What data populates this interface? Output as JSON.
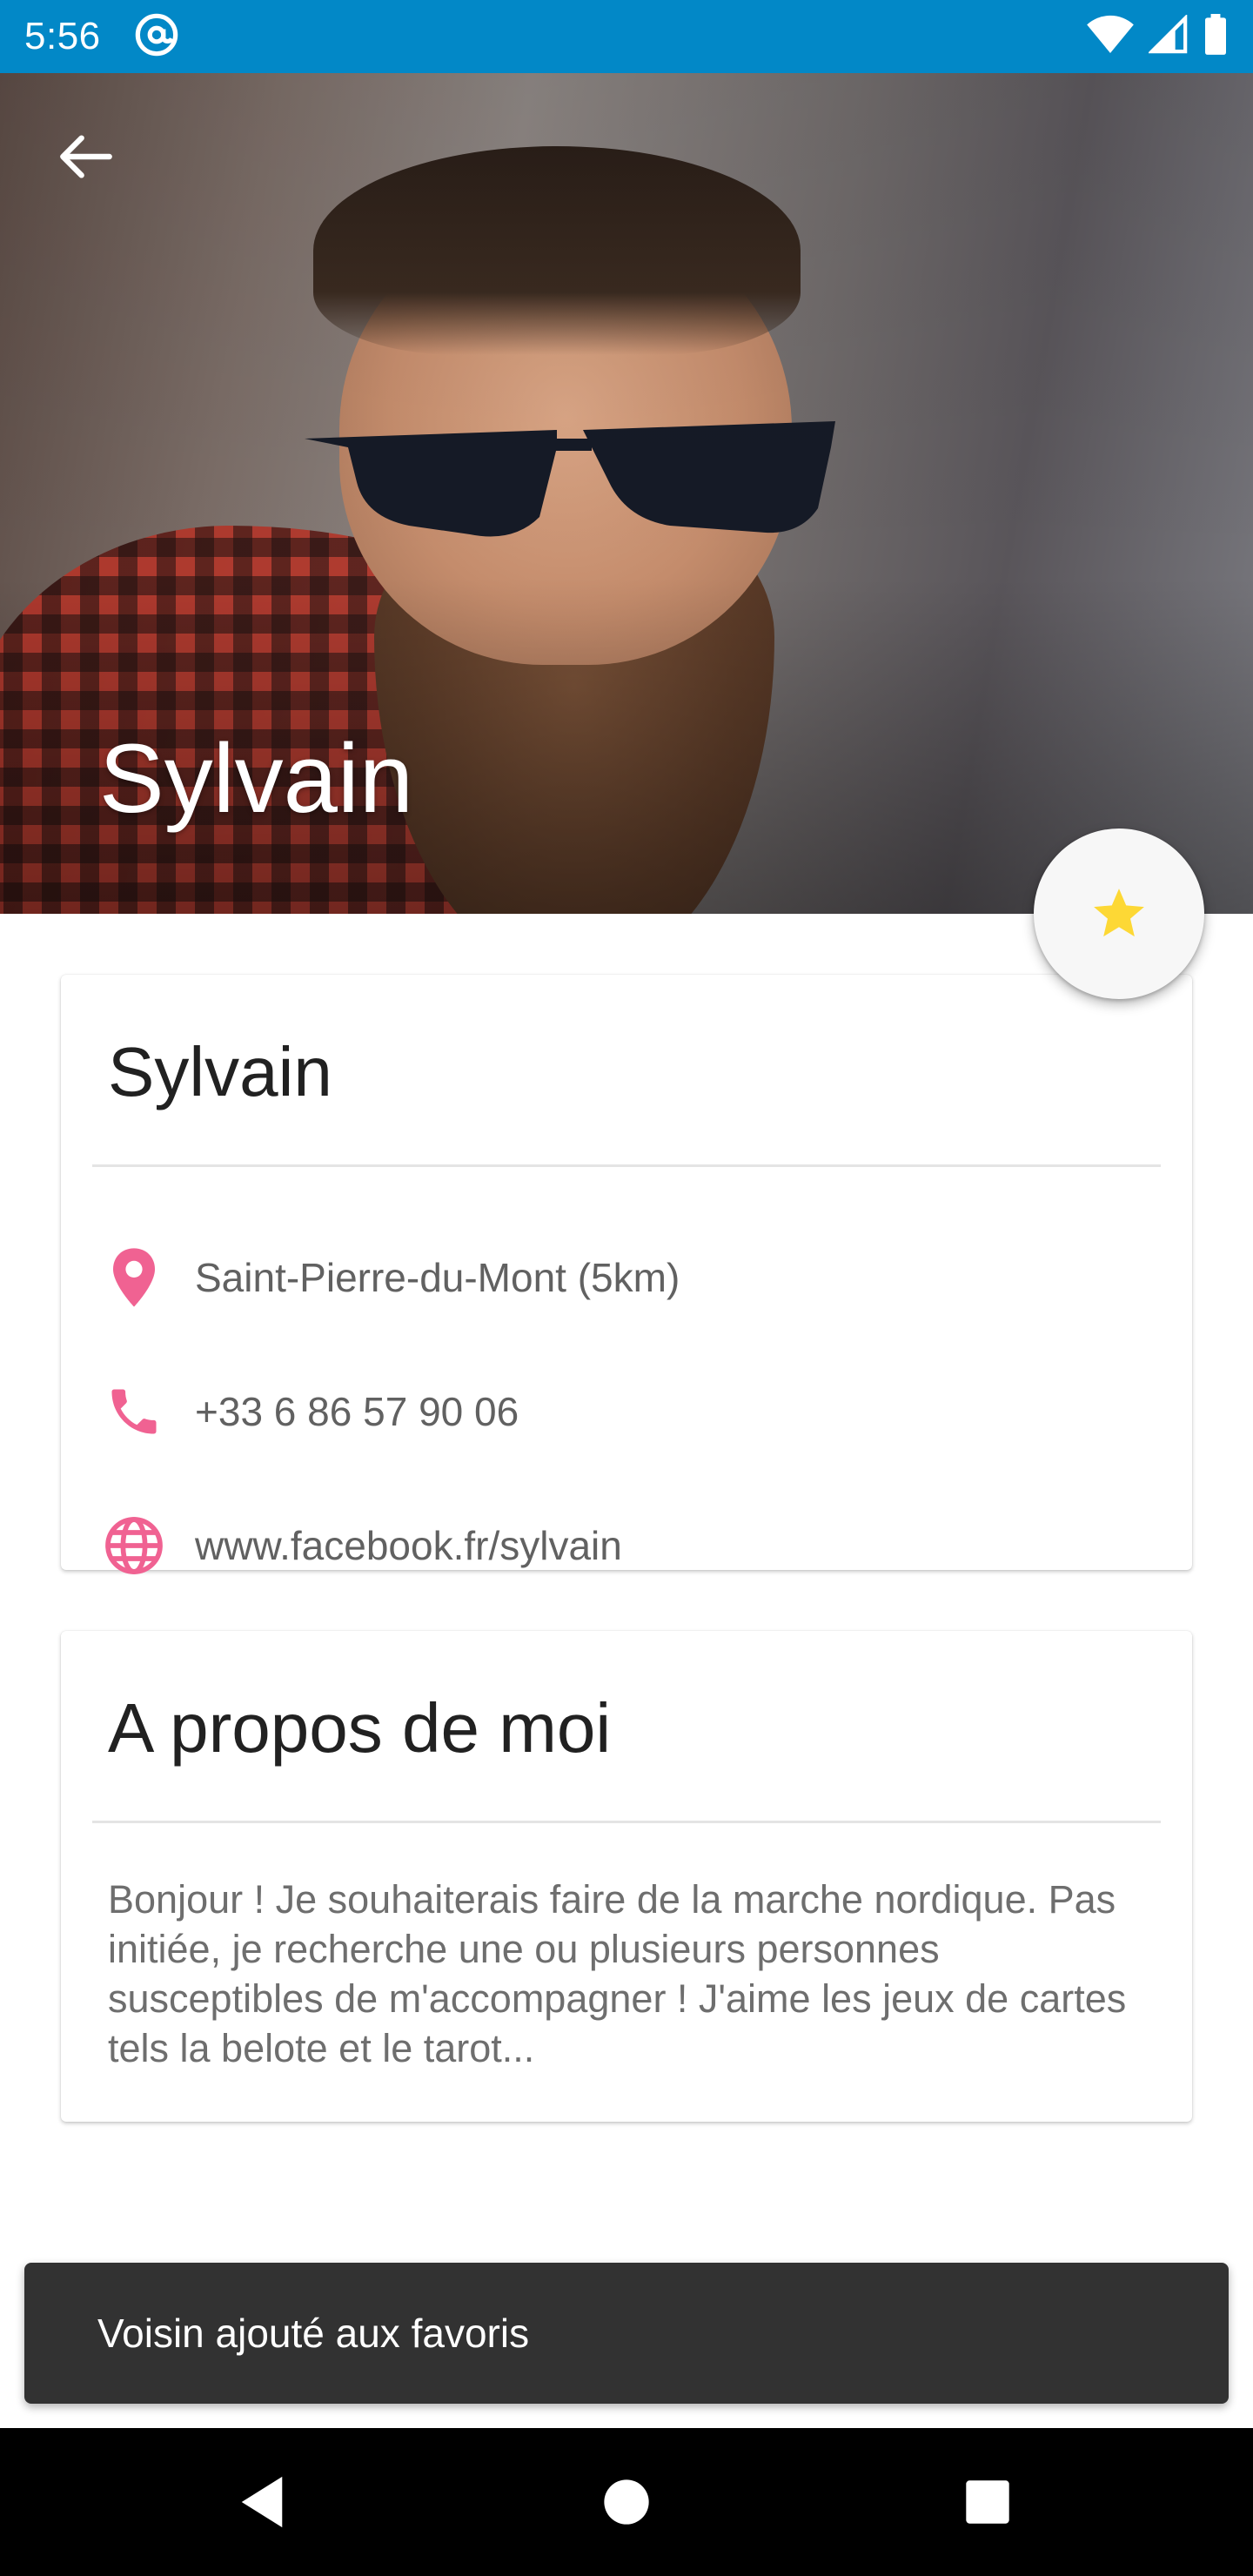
{
  "status_bar": {
    "time": "5:56",
    "app_icon": "at-sign-icon",
    "icons": [
      "wifi-icon",
      "cellular-signal-icon",
      "battery-icon"
    ],
    "background_color": "#0288c7"
  },
  "header": {
    "title": "Sylvain",
    "back_icon": "arrow-back-icon",
    "image_description_icon": "profile-photo"
  },
  "fab": {
    "icon": "star-icon",
    "icon_color": "#fdd835"
  },
  "info_card": {
    "name": "Sylvain",
    "rows": [
      {
        "icon": "location-pin-icon",
        "text": "Saint-Pierre-du-Mont (5km)"
      },
      {
        "icon": "phone-icon",
        "text": "+33 6 86 57 90 06"
      },
      {
        "icon": "globe-icon",
        "text": "www.facebook.fr/sylvain"
      }
    ],
    "icon_color": "#f06292"
  },
  "about_card": {
    "title": "A propos de moi",
    "text": "Bonjour ! Je souhaiterais faire de la marche nordique. Pas initiée, je recherche une ou plusieurs personnes susceptibles de m'accompagner ! J'aime les jeux de cartes tels la belote et le tarot..."
  },
  "snackbar": {
    "message": "Voisin ajouté aux favoris"
  },
  "nav_bar": {
    "buttons": [
      "back-triangle-icon",
      "home-circle-icon",
      "recents-square-icon"
    ]
  }
}
